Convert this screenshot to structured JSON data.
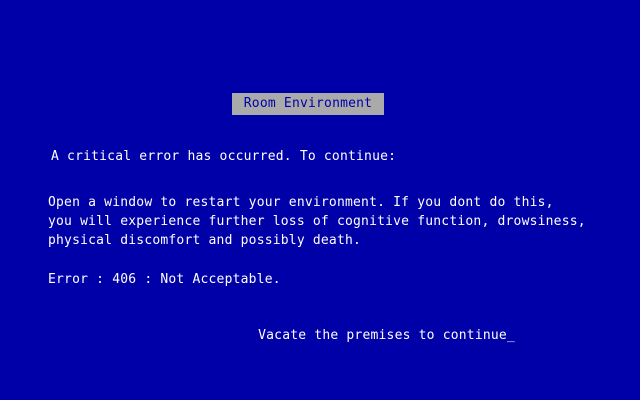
{
  "screen": {
    "background_color": "#0000a8",
    "text_color": "#ffffff",
    "title_bar_color": "#aaaaaa",
    "title_text_color": "#0000a8"
  },
  "title": "Room Environment",
  "message": {
    "intro": "A critical error has occurred. To continue:",
    "body_lines": [
      "Open a window to restart your environment. If you dont do this,",
      "you will experience further loss of cognitive function, drowsiness,",
      "physical discomfort and possibly death."
    ],
    "error": "Error : 406 : Not Acceptable."
  },
  "prompt": {
    "text": "Vacate the premises to continue",
    "cursor": "_"
  }
}
